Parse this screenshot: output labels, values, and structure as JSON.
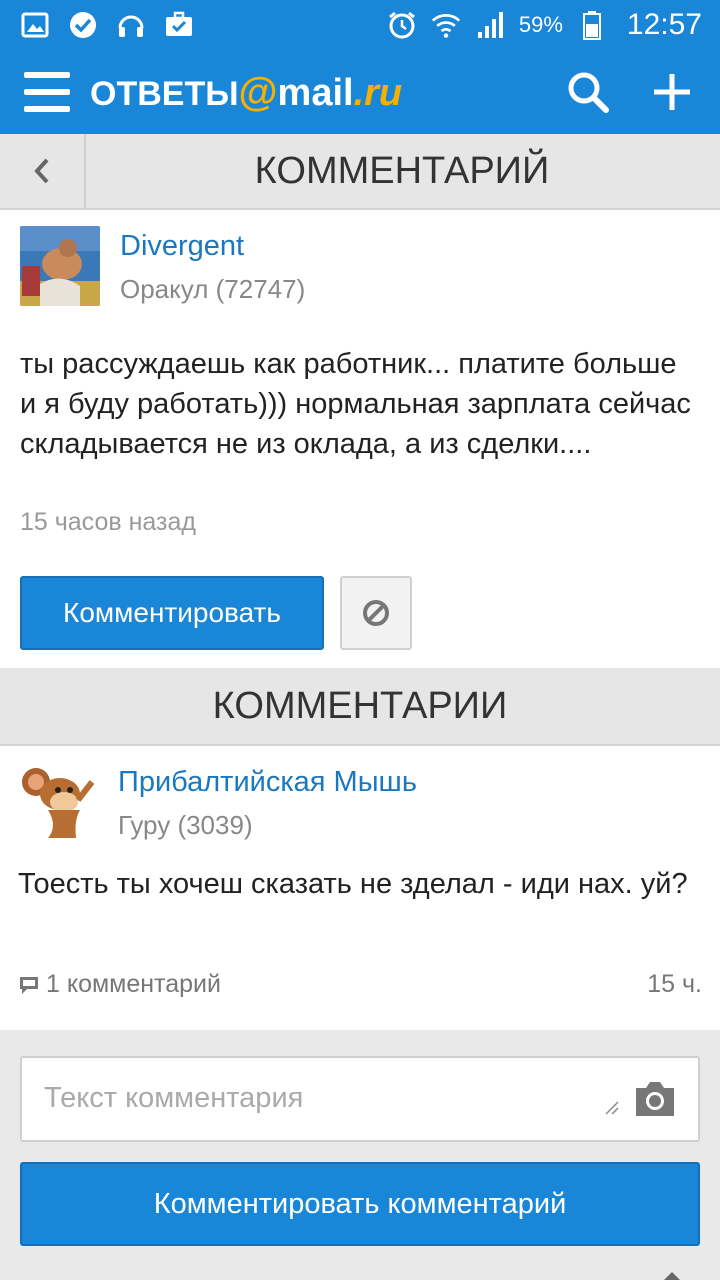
{
  "status_bar": {
    "battery": "59%",
    "time": "12:57",
    "left_icons": [
      "gallery-icon",
      "check-circle-icon",
      "headset-icon",
      "briefcase-check-icon"
    ],
    "right_icons": [
      "alarm-icon",
      "wifi-icon",
      "signal-icon",
      "battery-icon"
    ]
  },
  "app_bar": {
    "logo_part1": "ОТВЕТЫ",
    "logo_at": "@",
    "logo_part2": "mail",
    "logo_part3": ".ru",
    "brand_color": "#1a86d8",
    "accent_color": "#f6b000"
  },
  "title_bar": {
    "title": "КОММЕНТАРИЙ"
  },
  "post": {
    "author": "Divergent",
    "rank": "Оракул (72747)",
    "text": "ты рассуждаешь как работник... платите больше и я буду работать))) нормальная зарплата сейчас складывается не из оклада, а из сделки....",
    "time": "15 часов назад",
    "comment_button": "Комментировать"
  },
  "comments_section": {
    "title": "КОММЕНТАРИИ"
  },
  "reply": {
    "author": "Прибалтийская Мышь",
    "rank": "Гуру (3039)",
    "text": "Тоесть ты хочеш сказать не зделал - иди нах. уй?",
    "comments_count": "1 комментарий",
    "time": "15 ч."
  },
  "input": {
    "placeholder": "Текст комментария",
    "submit_label": "Комментировать комментарий"
  }
}
